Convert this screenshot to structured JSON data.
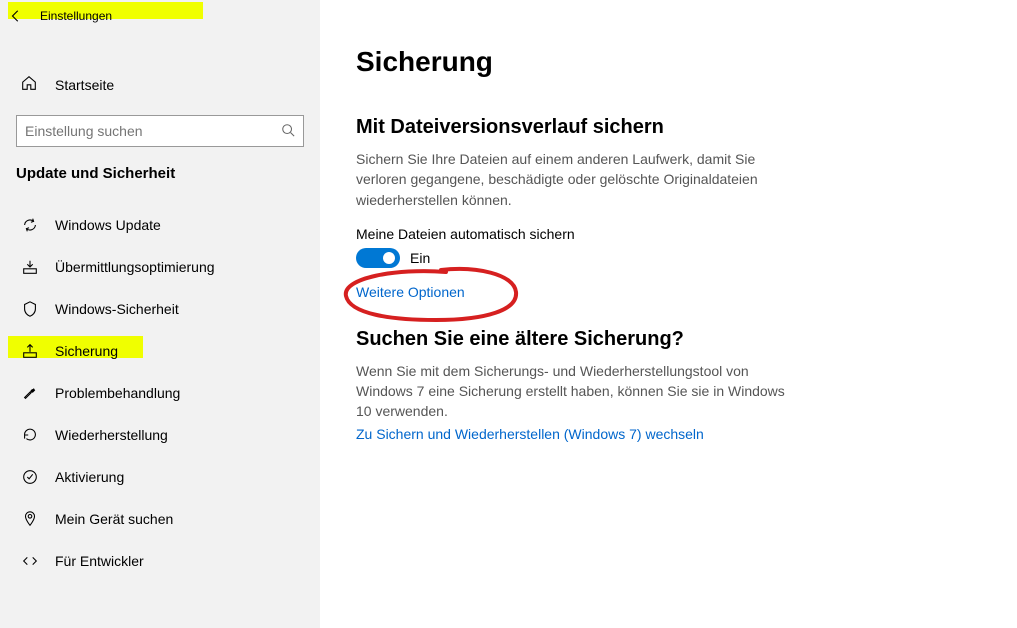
{
  "window": {
    "title": "Einstellungen"
  },
  "sidebar": {
    "home": "Startseite",
    "search_placeholder": "Einstellung suchen",
    "category": "Update und Sicherheit",
    "items": [
      {
        "label": "Windows Update"
      },
      {
        "label": "Übermittlungsoptimierung"
      },
      {
        "label": "Windows-Sicherheit"
      },
      {
        "label": "Sicherung",
        "selected": true
      },
      {
        "label": "Problembehandlung"
      },
      {
        "label": "Wiederherstellung"
      },
      {
        "label": "Aktivierung"
      },
      {
        "label": "Mein Gerät suchen"
      },
      {
        "label": "Für Entwickler"
      }
    ]
  },
  "main": {
    "title": "Sicherung",
    "file_history": {
      "heading": "Mit Dateiversionsverlauf sichern",
      "desc": "Sichern Sie Ihre Dateien auf einem anderen Laufwerk, damit Sie verloren gegangene, beschädigte oder gelöschte Originaldateien wiederherstellen können.",
      "toggle_label": "Meine Dateien automatisch sichern",
      "toggle_state": "Ein",
      "more_options": "Weitere Optionen"
    },
    "legacy": {
      "heading": "Suchen Sie eine ältere Sicherung?",
      "desc": "Wenn Sie mit dem Sicherungs- und Wiederherstellungstool von Windows 7 eine Sicherung erstellt haben, können Sie sie in Windows 10 verwenden.",
      "link": "Zu Sichern und Wiederherstellen (Windows 7) wechseln"
    }
  }
}
